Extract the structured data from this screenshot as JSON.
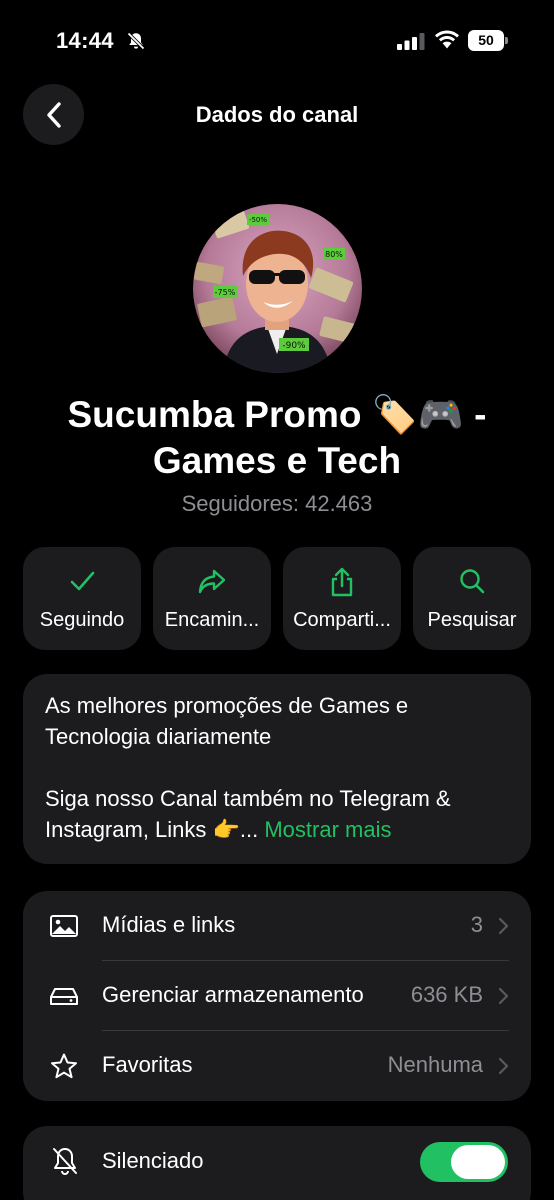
{
  "status_bar": {
    "time": "14:44",
    "battery": "50"
  },
  "nav": {
    "title": "Dados do canal"
  },
  "channel": {
    "name_line1": "Sucumba Promo 🏷️🎮  -",
    "name_line2": "Games e Tech",
    "followers": "Seguidores: 42.463",
    "avatar_tags": [
      "-50%",
      "80%",
      "-75%",
      "-90%"
    ]
  },
  "actions": [
    {
      "label": "Seguindo",
      "icon": "check-icon"
    },
    {
      "label": "Encamin...",
      "icon": "forward-icon"
    },
    {
      "label": "Comparti...",
      "icon": "share-icon"
    },
    {
      "label": "Pesquisar",
      "icon": "search-icon"
    }
  ],
  "description": {
    "line1": "As melhores promoções de Games e",
    "line2": "Tecnologia diariamente",
    "line3": "Siga nosso Canal também no Telegram &",
    "line4_text": "Instagram, Links 👉... ",
    "show_more": "Mostrar mais"
  },
  "list": [
    {
      "title": "Mídias e links",
      "value": "3",
      "icon": "image-icon"
    },
    {
      "title": "Gerenciar armazenamento",
      "value": "636 KB",
      "icon": "storage-icon"
    },
    {
      "title": "Favoritas",
      "value": "Nenhuma",
      "icon": "star-icon"
    }
  ],
  "mute": {
    "title": "Silenciado",
    "icon": "bell-off-icon",
    "enabled": true
  },
  "colors": {
    "accent": "#21c063",
    "card": "#1c1c1e",
    "secondary_text": "#8e8e93",
    "background": "#000000"
  }
}
